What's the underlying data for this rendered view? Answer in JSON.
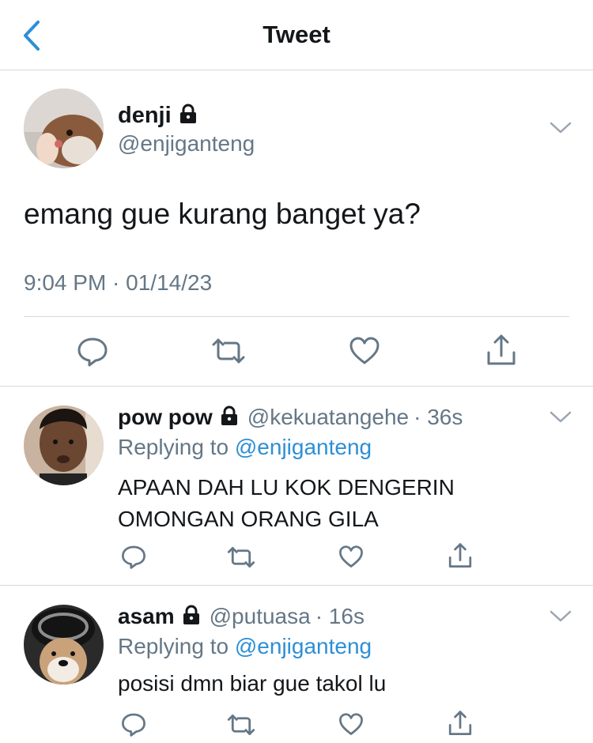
{
  "header": {
    "title": "Tweet"
  },
  "main_tweet": {
    "name": "denji",
    "handle": "@enjiganteng",
    "text": "emang gue kurang banget ya?",
    "timestamp": "9:04 PM · 01/14/23"
  },
  "replies": [
    {
      "name": "pow pow",
      "handle": "@kekuatangehe",
      "time": "· 36s",
      "replying_label": "Replying to",
      "replying_to": "@enjiganteng",
      "text_line1": "APAAN DAH LU KOK DENGERIN",
      "text_line2": "OMONGAN ORANG GILA"
    },
    {
      "name": "asam",
      "handle": "@putuasa",
      "time": "· 16s",
      "replying_label": "Replying to",
      "replying_to": "@enjiganteng",
      "text_line1": "posisi dmn biar gue takol lu"
    }
  ],
  "icons": {
    "back": "chevron-left-icon",
    "lock": "lock-icon",
    "more": "chevron-down-icon",
    "reply": "reply-icon",
    "retweet": "retweet-icon",
    "like": "heart-icon",
    "share": "share-icon"
  },
  "colors": {
    "accent": "#2d8fd6",
    "secondary_text": "#657786",
    "icon_gray": "#657786",
    "divider": "#d6d9dc"
  }
}
